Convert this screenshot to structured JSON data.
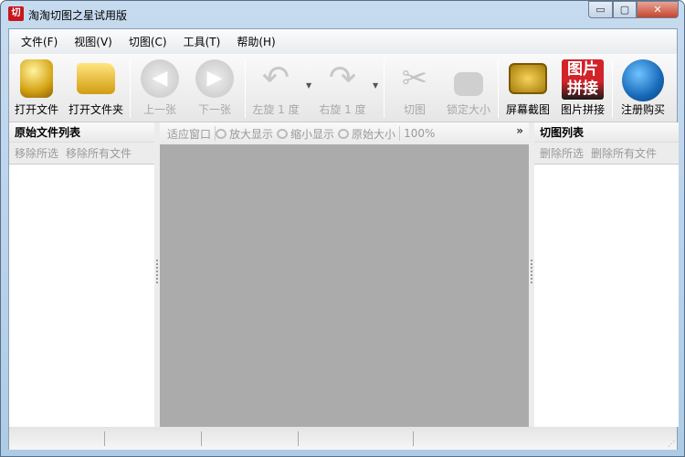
{
  "window": {
    "title": "淘淘切图之星试用版",
    "icon": "app-logo-icon",
    "minimize": "▭",
    "maximize": "▢",
    "close": "✕"
  },
  "menu": [
    "文件(F)",
    "视图(V)",
    "切图(C)",
    "工具(T)",
    "帮助(H)"
  ],
  "toolbar": {
    "open_file": "打开文件",
    "open_folder": "打开文件夹",
    "prev": "上一张",
    "next": "下一张",
    "rotate_left": "左旋 1 度",
    "rotate_right": "右旋 1 度",
    "cut": "切图",
    "lock_size": "锁定大小",
    "screenshot": "屏幕截图",
    "stitch": "图片拼接",
    "register": "注册购买",
    "stitch_icon_text": "图片拼接"
  },
  "left_panel": {
    "title": "原始文件列表",
    "remove_selected": "移除所选",
    "remove_all": "移除所有文件"
  },
  "view_bar": {
    "fit": "适应窗口",
    "zoom_in": "放大显示",
    "zoom_out": "缩小显示",
    "original": "原始大小",
    "zoom_level": "100%",
    "more": "»"
  },
  "right_panel": {
    "title": "切图列表",
    "delete_selected": "删除所选",
    "delete_all": "删除所有文件"
  },
  "colors": {
    "canvas": "#ababab",
    "brand_red": "#c8161d",
    "gold": "#d4a017"
  }
}
